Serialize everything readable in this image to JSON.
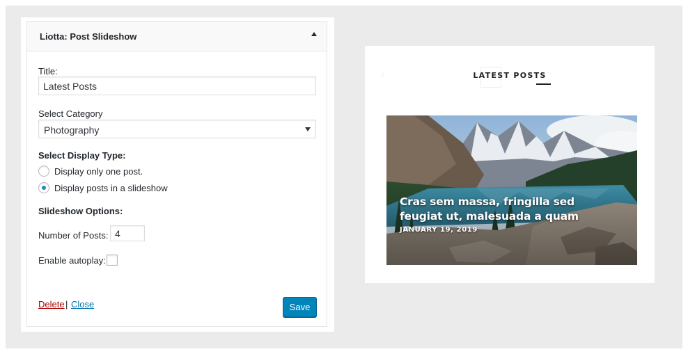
{
  "widget": {
    "title": "Liotta: Post Slideshow",
    "title_label": "Title:",
    "title_value": "Latest Posts",
    "category_label": "Select Category",
    "category_value": "Photography",
    "display_type_label": "Select Display Type:",
    "display_options": [
      {
        "label": "Display only one post.",
        "checked": false
      },
      {
        "label": "Display posts in a slideshow",
        "checked": true
      }
    ],
    "slideshow_options_label": "Slideshow Options:",
    "num_posts_label": "Number of Posts:",
    "num_posts_value": "4",
    "autoplay_label": "Enable autoplay:",
    "autoplay_checked": false,
    "delete_label": "Delete",
    "separator": "|",
    "close_label": "Close",
    "save_label": "Save"
  },
  "preview": {
    "section_title": "LATEST POSTS",
    "slide": {
      "title": "Cras sem massa, fringilla sed feugiat ut, malesuada a quam",
      "date": "JANUARY 19, 2019"
    }
  },
  "colors": {
    "primary_button": "#0085ba",
    "delete_link": "#a00",
    "close_link": "#0073aa",
    "radio_dot": "#1e8cbe",
    "background": "#ebebeb"
  },
  "icons": {
    "toggle": "triangle-up-icon",
    "select": "caret-down-icon"
  }
}
